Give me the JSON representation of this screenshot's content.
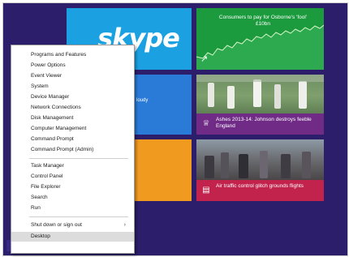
{
  "colors": {
    "desktop_bg": "#2c1e6a",
    "skype_tile": "#1ba1e2",
    "money_tile": "#1c9a3e",
    "blue_tile": "#2a7bd8",
    "orange_tile": "#f09a20",
    "sport_caption": "#6f2b86",
    "news_caption": "#c2234c"
  },
  "tiles": {
    "skype_logo": "skype",
    "money_headline": "Consumers to pay for Osborne's 'fool' £10bn",
    "blue_partial_text": "loudy",
    "sport_headline": "Ashes 2013-14: Johnson destroys feeble England",
    "news_headline": "Air traffic control glitch grounds flights"
  },
  "icons": {
    "money": "chart-icon",
    "sport": "trophy-icon",
    "news": "newspaper-icon"
  },
  "menu": {
    "items": [
      {
        "label": "Programs and Features"
      },
      {
        "label": "Power Options"
      },
      {
        "label": "Event Viewer"
      },
      {
        "label": "System"
      },
      {
        "label": "Device Manager"
      },
      {
        "label": "Network Connections"
      },
      {
        "label": "Disk Management"
      },
      {
        "label": "Computer Management"
      },
      {
        "label": "Command Prompt"
      },
      {
        "label": "Command Prompt (Admin)"
      },
      {
        "label": "Task Manager"
      },
      {
        "label": "Control Panel"
      },
      {
        "label": "File Explorer"
      },
      {
        "label": "Search"
      },
      {
        "label": "Run"
      },
      {
        "label": "Shut down or sign out"
      },
      {
        "label": "Desktop"
      }
    ],
    "submenu_arrow": "›",
    "selected": "Desktop"
  }
}
